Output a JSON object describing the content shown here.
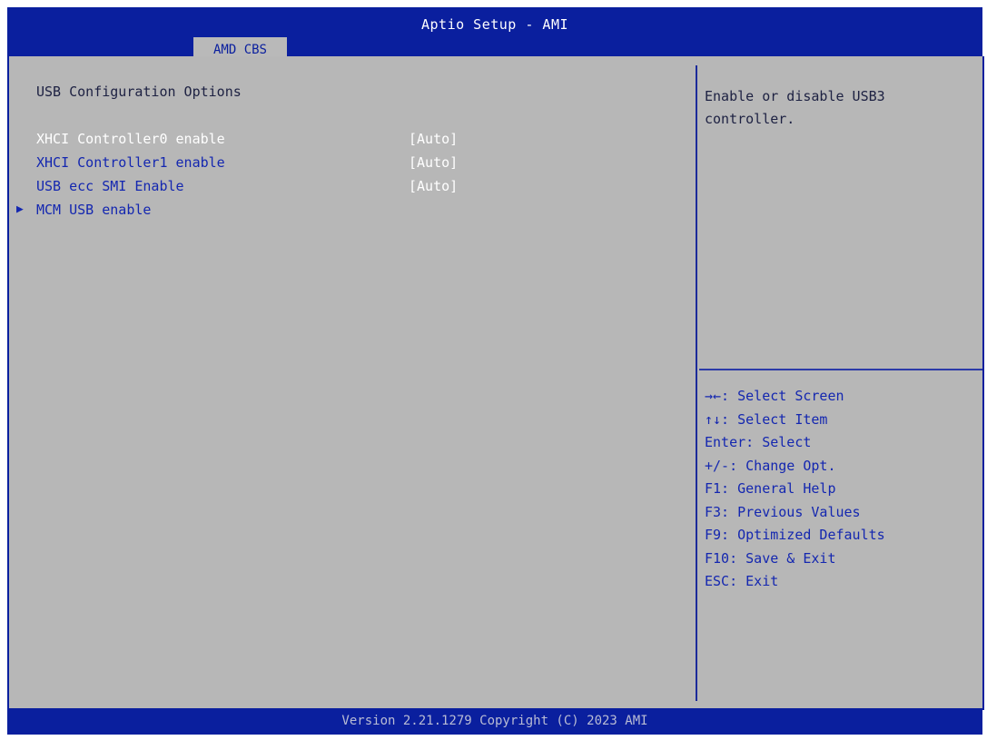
{
  "header": {
    "title": "Aptio Setup - AMI",
    "tab_label": "AMD CBS"
  },
  "main": {
    "section_title": "USB Configuration Options",
    "items": [
      {
        "label": "XHCI Controller0 enable",
        "value": "[Auto]"
      },
      {
        "label": "XHCI Controller1 enable",
        "value": "[Auto]"
      },
      {
        "label": "USB ecc SMI Enable",
        "value": "[Auto]"
      },
      {
        "label": "MCM USB enable",
        "value": ""
      }
    ],
    "submenu_arrow": "▶"
  },
  "help": {
    "text": "Enable or disable USB3\ncontroller."
  },
  "keys": [
    "→←: Select Screen",
    "↑↓: Select Item",
    "Enter: Select",
    "+/-: Change Opt.",
    "F1: General Help",
    "F3: Previous Values",
    "F9: Optimized Defaults",
    "F10: Save & Exit",
    "ESC: Exit"
  ],
  "footer": {
    "version": "Version 2.21.1279 Copyright (C) 2023 AMI"
  },
  "colors": {
    "bar_blue": "#0a1f9e",
    "panel_gray": "#b7b7b7",
    "label_blue": "#1427b0",
    "value_white": "#ffffff"
  }
}
